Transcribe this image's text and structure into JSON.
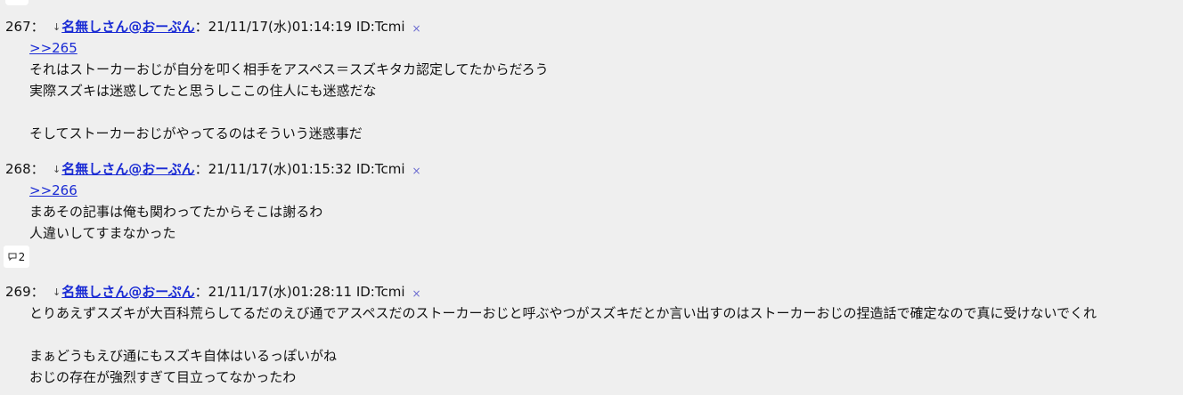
{
  "posts": [
    {
      "number": "267：",
      "arrow": "↓",
      "author": "名無しさん@おーぷん",
      "meta": "：21/11/17(水)01:14:19 ID:Tcmi",
      "close_glyph": "×",
      "reply_link": ">>265",
      "lines": [
        "それはストーカーおじが自分を叩く相手をアスペス＝スズキタカ認定してたからだろう",
        "実際スズキは迷惑してたと思うしここの住人にも迷惑だな",
        "",
        "そしてストーカーおじがやってるのはそういう迷惑事だ"
      ]
    },
    {
      "number": "268：",
      "arrow": "↓",
      "author": "名無しさん@おーぷん",
      "meta": "：21/11/17(水)01:15:32 ID:Tcmi",
      "close_glyph": "×",
      "reply_link": ">>266",
      "lines": [
        "まあその記事は俺も関わってたからそこは謝るわ",
        "人違いしてすまなかった"
      ],
      "reply_count": "2"
    },
    {
      "number": "269：",
      "arrow": "↓",
      "author": "名無しさん@おーぷん",
      "meta": "：21/11/17(水)01:28:11 ID:Tcmi",
      "close_glyph": "×",
      "lines": [
        "とりあえずスズキが大百科荒らしてるだのえび通でアスペスだのストーカーおじと呼ぶやつがスズキだとか言い出すのはストーカーおじの捏造話で確定なので真に受けないでくれ",
        "",
        "まぁどうもえび通にもスズキ自体はいるっぽいがね",
        "おじの存在が強烈すぎて目立ってなかったわ"
      ]
    }
  ]
}
